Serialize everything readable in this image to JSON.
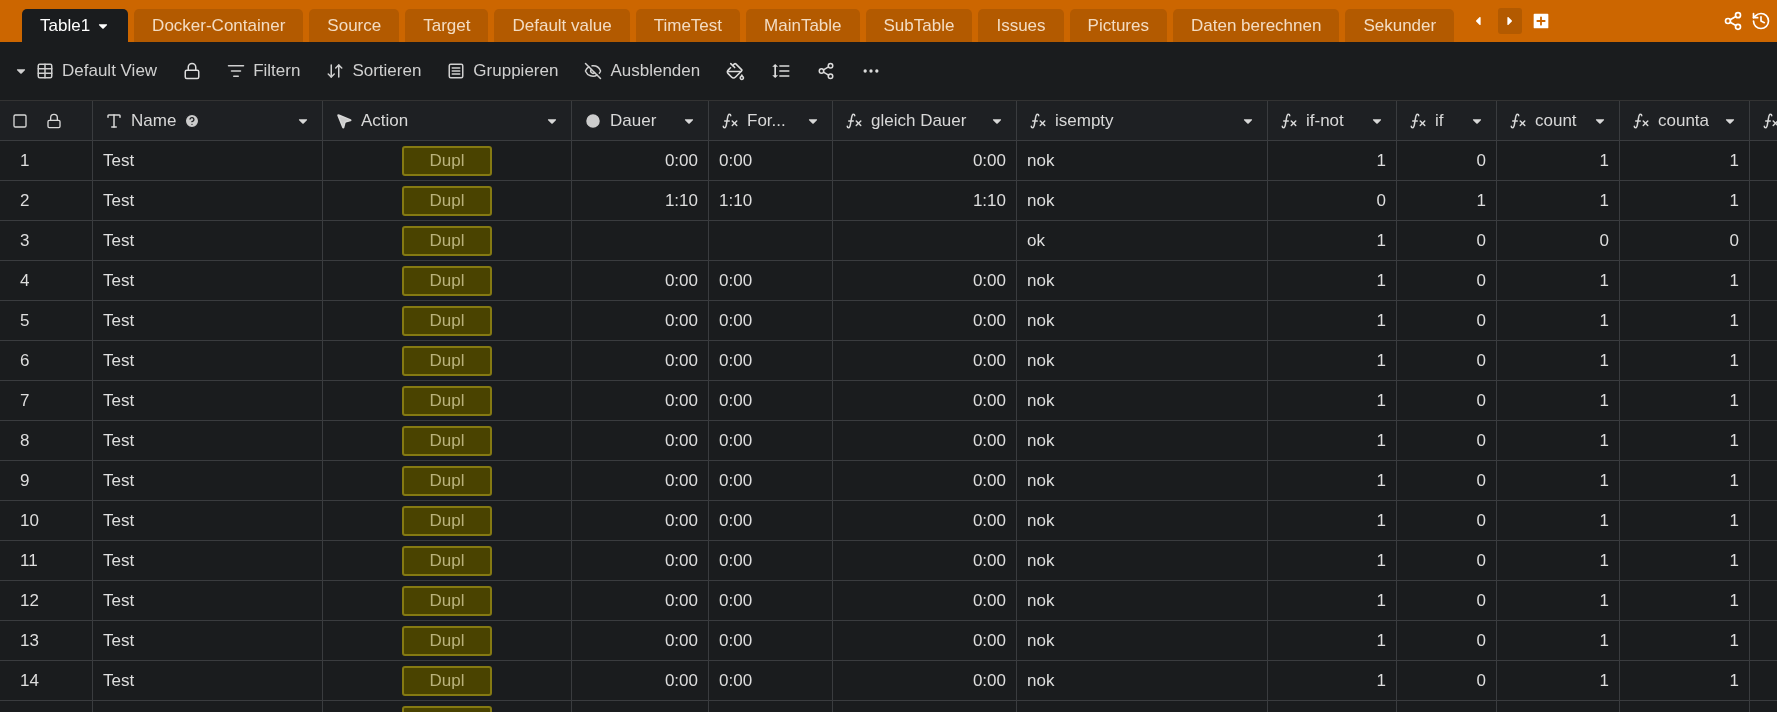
{
  "tabs": [
    {
      "label": "Table1",
      "selected": true
    },
    {
      "label": "Docker-Container",
      "selected": false
    },
    {
      "label": "Source",
      "selected": false
    },
    {
      "label": "Target",
      "selected": false
    },
    {
      "label": "Default value",
      "selected": false
    },
    {
      "label": "TimeTest",
      "selected": false
    },
    {
      "label": "MainTable",
      "selected": false
    },
    {
      "label": "SubTable",
      "selected": false
    },
    {
      "label": "Issues",
      "selected": false
    },
    {
      "label": "Pictures",
      "selected": false
    },
    {
      "label": "Daten berechnen",
      "selected": false
    },
    {
      "label": "Sekunder",
      "selected": false
    }
  ],
  "toolbar": {
    "view": "Default View",
    "actions": [
      {
        "kind": "filter",
        "label": "Filtern"
      },
      {
        "kind": "sort",
        "label": "Sortieren"
      },
      {
        "kind": "group",
        "label": "Gruppieren"
      },
      {
        "kind": "hide",
        "label": "Ausblenden"
      }
    ]
  },
  "select_all": {
    "checked": false
  },
  "columns": [
    {
      "label": "Name",
      "kind": "text",
      "numeric": false,
      "help": true
    },
    {
      "label": "Action",
      "kind": "button"
    },
    {
      "label": "Dauer",
      "kind": "duration",
      "numeric": true
    },
    {
      "label": "For...",
      "kind": "formula",
      "numeric": false
    },
    {
      "label": "gleich Dauer",
      "kind": "formula",
      "numeric": true
    },
    {
      "label": "isempty",
      "kind": "formula",
      "numeric": false
    },
    {
      "label": "if-not",
      "kind": "formula",
      "numeric": true
    },
    {
      "label": "if",
      "kind": "formula",
      "numeric": true
    },
    {
      "label": "count",
      "kind": "formula",
      "numeric": true
    },
    {
      "label": "counta",
      "kind": "formula",
      "numeric": true
    },
    {
      "kind": "formula"
    }
  ],
  "rows": [
    {
      "number": "1",
      "cells": [
        "Test",
        "Dupl",
        "0:00",
        "0:00",
        "0:00",
        "nok",
        "1",
        "0",
        "1",
        "1"
      ]
    },
    {
      "number": "2",
      "cells": [
        "Test",
        "Dupl",
        "1:10",
        "1:10",
        "1:10",
        "nok",
        "0",
        "1",
        "1",
        "1"
      ]
    },
    {
      "number": "3",
      "cells": [
        "Test",
        "Dupl",
        "",
        "",
        "",
        "ok",
        "1",
        "0",
        "0",
        "0"
      ]
    },
    {
      "number": "4",
      "cells": [
        "Test",
        "Dupl",
        "0:00",
        "0:00",
        "0:00",
        "nok",
        "1",
        "0",
        "1",
        "1"
      ]
    },
    {
      "number": "5",
      "cells": [
        "Test",
        "Dupl",
        "0:00",
        "0:00",
        "0:00",
        "nok",
        "1",
        "0",
        "1",
        "1"
      ]
    },
    {
      "number": "6",
      "cells": [
        "Test",
        "Dupl",
        "0:00",
        "0:00",
        "0:00",
        "nok",
        "1",
        "0",
        "1",
        "1"
      ]
    },
    {
      "number": "7",
      "cells": [
        "Test",
        "Dupl",
        "0:00",
        "0:00",
        "0:00",
        "nok",
        "1",
        "0",
        "1",
        "1"
      ]
    },
    {
      "number": "8",
      "cells": [
        "Test",
        "Dupl",
        "0:00",
        "0:00",
        "0:00",
        "nok",
        "1",
        "0",
        "1",
        "1"
      ]
    },
    {
      "number": "9",
      "cells": [
        "Test",
        "Dupl",
        "0:00",
        "0:00",
        "0:00",
        "nok",
        "1",
        "0",
        "1",
        "1"
      ]
    },
    {
      "number": "10",
      "cells": [
        "Test",
        "Dupl",
        "0:00",
        "0:00",
        "0:00",
        "nok",
        "1",
        "0",
        "1",
        "1"
      ]
    },
    {
      "number": "11",
      "cells": [
        "Test",
        "Dupl",
        "0:00",
        "0:00",
        "0:00",
        "nok",
        "1",
        "0",
        "1",
        "1"
      ]
    },
    {
      "number": "12",
      "cells": [
        "Test",
        "Dupl",
        "0:00",
        "0:00",
        "0:00",
        "nok",
        "1",
        "0",
        "1",
        "1"
      ]
    },
    {
      "number": "13",
      "cells": [
        "Test",
        "Dupl",
        "0:00",
        "0:00",
        "0:00",
        "nok",
        "1",
        "0",
        "1",
        "1"
      ]
    },
    {
      "number": "14",
      "cells": [
        "Test",
        "Dupl",
        "0:00",
        "0:00",
        "0:00",
        "nok",
        "1",
        "0",
        "1",
        "1"
      ]
    }
  ]
}
